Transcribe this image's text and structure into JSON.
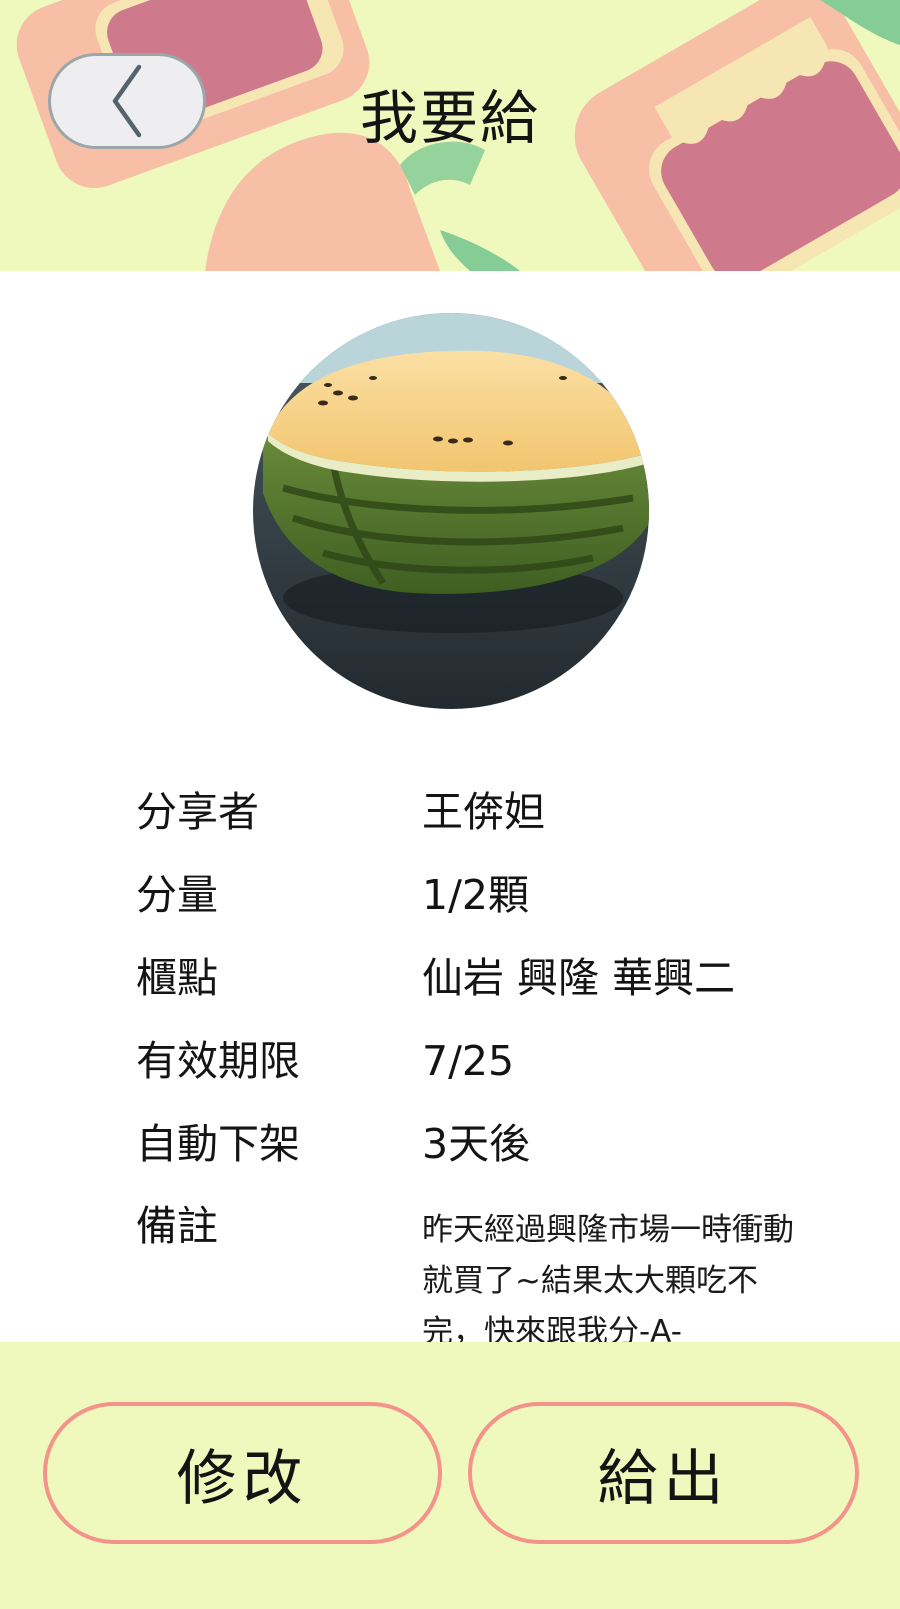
{
  "header": {
    "title": "我要給",
    "back_icon": "chevron-left-icon",
    "colors": {
      "background": "#eff8bd",
      "pink": "#f7bfa6",
      "magenta": "#cf7a8c",
      "cream": "#f6e6b4",
      "green": "#86cc96"
    }
  },
  "photo": {
    "subject": "half-watermelon-photo"
  },
  "details": {
    "rows": [
      {
        "label": "分享者",
        "value": "王倴妲"
      },
      {
        "label": "分量",
        "value": "1/2顆"
      },
      {
        "label": "櫃點",
        "value": "仙岩 興隆 華興二"
      },
      {
        "label": "有效期限",
        "value": "7/25"
      },
      {
        "label": "自動下架",
        "value": "3天後"
      }
    ],
    "note_label": "備註",
    "note_value": "昨天經過興隆市場一時衝動就買了~結果太大顆吃不完，快來跟我分-A-"
  },
  "footer": {
    "edit_label": "修改",
    "give_label": "給出",
    "border_color": "#f4928c"
  }
}
